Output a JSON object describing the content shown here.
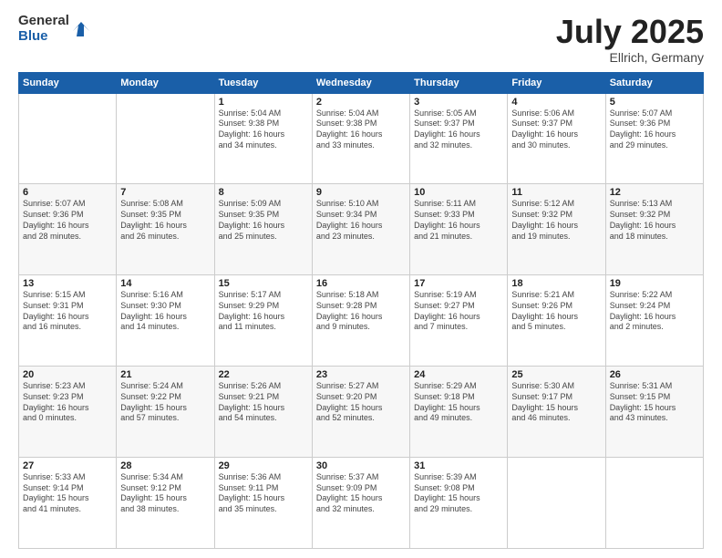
{
  "header": {
    "logo_general": "General",
    "logo_blue": "Blue",
    "month_title": "July 2025",
    "subtitle": "Ellrich, Germany"
  },
  "days_of_week": [
    "Sunday",
    "Monday",
    "Tuesday",
    "Wednesday",
    "Thursday",
    "Friday",
    "Saturday"
  ],
  "weeks": [
    [
      {
        "day": "",
        "info": ""
      },
      {
        "day": "",
        "info": ""
      },
      {
        "day": "1",
        "info": "Sunrise: 5:04 AM\nSunset: 9:38 PM\nDaylight: 16 hours\nand 34 minutes."
      },
      {
        "day": "2",
        "info": "Sunrise: 5:04 AM\nSunset: 9:38 PM\nDaylight: 16 hours\nand 33 minutes."
      },
      {
        "day": "3",
        "info": "Sunrise: 5:05 AM\nSunset: 9:37 PM\nDaylight: 16 hours\nand 32 minutes."
      },
      {
        "day": "4",
        "info": "Sunrise: 5:06 AM\nSunset: 9:37 PM\nDaylight: 16 hours\nand 30 minutes."
      },
      {
        "day": "5",
        "info": "Sunrise: 5:07 AM\nSunset: 9:36 PM\nDaylight: 16 hours\nand 29 minutes."
      }
    ],
    [
      {
        "day": "6",
        "info": "Sunrise: 5:07 AM\nSunset: 9:36 PM\nDaylight: 16 hours\nand 28 minutes."
      },
      {
        "day": "7",
        "info": "Sunrise: 5:08 AM\nSunset: 9:35 PM\nDaylight: 16 hours\nand 26 minutes."
      },
      {
        "day": "8",
        "info": "Sunrise: 5:09 AM\nSunset: 9:35 PM\nDaylight: 16 hours\nand 25 minutes."
      },
      {
        "day": "9",
        "info": "Sunrise: 5:10 AM\nSunset: 9:34 PM\nDaylight: 16 hours\nand 23 minutes."
      },
      {
        "day": "10",
        "info": "Sunrise: 5:11 AM\nSunset: 9:33 PM\nDaylight: 16 hours\nand 21 minutes."
      },
      {
        "day": "11",
        "info": "Sunrise: 5:12 AM\nSunset: 9:32 PM\nDaylight: 16 hours\nand 19 minutes."
      },
      {
        "day": "12",
        "info": "Sunrise: 5:13 AM\nSunset: 9:32 PM\nDaylight: 16 hours\nand 18 minutes."
      }
    ],
    [
      {
        "day": "13",
        "info": "Sunrise: 5:15 AM\nSunset: 9:31 PM\nDaylight: 16 hours\nand 16 minutes."
      },
      {
        "day": "14",
        "info": "Sunrise: 5:16 AM\nSunset: 9:30 PM\nDaylight: 16 hours\nand 14 minutes."
      },
      {
        "day": "15",
        "info": "Sunrise: 5:17 AM\nSunset: 9:29 PM\nDaylight: 16 hours\nand 11 minutes."
      },
      {
        "day": "16",
        "info": "Sunrise: 5:18 AM\nSunset: 9:28 PM\nDaylight: 16 hours\nand 9 minutes."
      },
      {
        "day": "17",
        "info": "Sunrise: 5:19 AM\nSunset: 9:27 PM\nDaylight: 16 hours\nand 7 minutes."
      },
      {
        "day": "18",
        "info": "Sunrise: 5:21 AM\nSunset: 9:26 PM\nDaylight: 16 hours\nand 5 minutes."
      },
      {
        "day": "19",
        "info": "Sunrise: 5:22 AM\nSunset: 9:24 PM\nDaylight: 16 hours\nand 2 minutes."
      }
    ],
    [
      {
        "day": "20",
        "info": "Sunrise: 5:23 AM\nSunset: 9:23 PM\nDaylight: 16 hours\nand 0 minutes."
      },
      {
        "day": "21",
        "info": "Sunrise: 5:24 AM\nSunset: 9:22 PM\nDaylight: 15 hours\nand 57 minutes."
      },
      {
        "day": "22",
        "info": "Sunrise: 5:26 AM\nSunset: 9:21 PM\nDaylight: 15 hours\nand 54 minutes."
      },
      {
        "day": "23",
        "info": "Sunrise: 5:27 AM\nSunset: 9:20 PM\nDaylight: 15 hours\nand 52 minutes."
      },
      {
        "day": "24",
        "info": "Sunrise: 5:29 AM\nSunset: 9:18 PM\nDaylight: 15 hours\nand 49 minutes."
      },
      {
        "day": "25",
        "info": "Sunrise: 5:30 AM\nSunset: 9:17 PM\nDaylight: 15 hours\nand 46 minutes."
      },
      {
        "day": "26",
        "info": "Sunrise: 5:31 AM\nSunset: 9:15 PM\nDaylight: 15 hours\nand 43 minutes."
      }
    ],
    [
      {
        "day": "27",
        "info": "Sunrise: 5:33 AM\nSunset: 9:14 PM\nDaylight: 15 hours\nand 41 minutes."
      },
      {
        "day": "28",
        "info": "Sunrise: 5:34 AM\nSunset: 9:12 PM\nDaylight: 15 hours\nand 38 minutes."
      },
      {
        "day": "29",
        "info": "Sunrise: 5:36 AM\nSunset: 9:11 PM\nDaylight: 15 hours\nand 35 minutes."
      },
      {
        "day": "30",
        "info": "Sunrise: 5:37 AM\nSunset: 9:09 PM\nDaylight: 15 hours\nand 32 minutes."
      },
      {
        "day": "31",
        "info": "Sunrise: 5:39 AM\nSunset: 9:08 PM\nDaylight: 15 hours\nand 29 minutes."
      },
      {
        "day": "",
        "info": ""
      },
      {
        "day": "",
        "info": ""
      }
    ]
  ]
}
